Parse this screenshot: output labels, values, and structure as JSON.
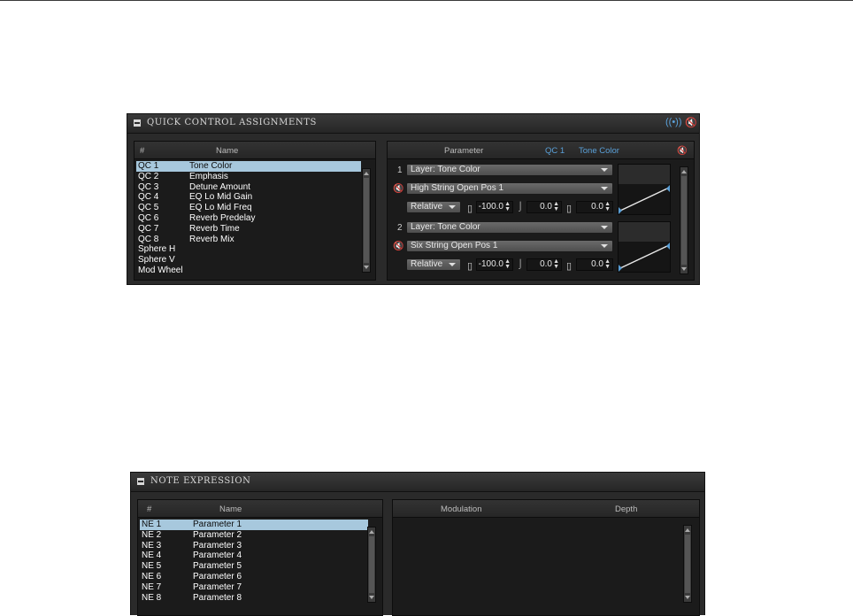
{
  "quick_control": {
    "title": "QUICK CONTROL ASSIGNMENTS",
    "list_headers": {
      "num": "#",
      "name": "Name"
    },
    "rows": [
      {
        "id": "QC 1",
        "name": "Tone Color",
        "selected": true
      },
      {
        "id": "QC 2",
        "name": "Emphasis"
      },
      {
        "id": "QC 3",
        "name": "Detune Amount"
      },
      {
        "id": "QC 4",
        "name": "EQ Lo Mid Gain"
      },
      {
        "id": "QC 5",
        "name": "EQ Lo Mid Freq"
      },
      {
        "id": "QC 6",
        "name": "Reverb Predelay"
      },
      {
        "id": "QC 7",
        "name": "Reverb Time"
      },
      {
        "id": "QC 8",
        "name": "Reverb Mix"
      },
      {
        "id": "Sphere H",
        "name": ""
      },
      {
        "id": "Sphere V",
        "name": ""
      },
      {
        "id": "Mod Wheel",
        "name": ""
      }
    ],
    "param_header": {
      "label": "Parameter",
      "qc": "QC 1",
      "qc_name": "Tone Color"
    },
    "slots": [
      {
        "num": "1",
        "parameter": "Layer: Tone Color",
        "source": "High String Open Pos 1",
        "mode": "Relative",
        "min": "-100.0",
        "curve": "0.0",
        "max": "0.0"
      },
      {
        "num": "2",
        "parameter": "Layer: Tone Color",
        "source": "Six String Open Pos 1",
        "mode": "Relative",
        "min": "-100.0",
        "curve": "0.0",
        "max": "0.0"
      }
    ],
    "accent_color": "#5aa0d8"
  },
  "note_expression": {
    "title": "NOTE EXPRESSION",
    "list_headers": {
      "num": "#",
      "name": "Name"
    },
    "rows": [
      {
        "id": "NE 1",
        "name": "Parameter 1",
        "selected": true
      },
      {
        "id": "NE 2",
        "name": "Parameter 2"
      },
      {
        "id": "NE 3",
        "name": "Parameter 3"
      },
      {
        "id": "NE 4",
        "name": "Parameter 4"
      },
      {
        "id": "NE 5",
        "name": "Parameter 5"
      },
      {
        "id": "NE 6",
        "name": "Parameter 6"
      },
      {
        "id": "NE 7",
        "name": "Parameter 7"
      },
      {
        "id": "NE 8",
        "name": "Parameter 8"
      }
    ],
    "detail_headers": {
      "modulation": "Modulation",
      "depth": "Depth"
    }
  }
}
